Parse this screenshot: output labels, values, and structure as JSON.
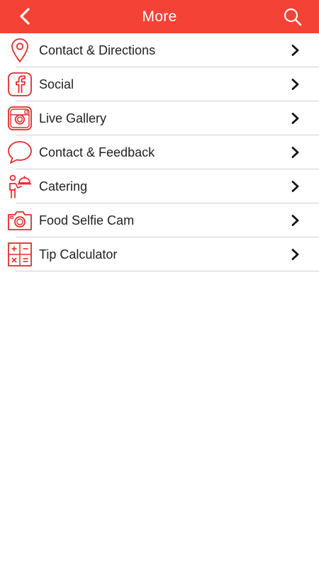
{
  "header": {
    "title": "More",
    "accent_color": "#f44336",
    "back_icon": "chevron-left-icon",
    "search_icon": "search-icon"
  },
  "menu": {
    "items": [
      {
        "label": "Contact & Directions",
        "icon": "map-pin-icon"
      },
      {
        "label": "Social",
        "icon": "facebook-icon"
      },
      {
        "label": "Live Gallery",
        "icon": "instagram-icon"
      },
      {
        "label": "Contact & Feedback",
        "icon": "speech-bubble-icon"
      },
      {
        "label": "Catering",
        "icon": "waiter-icon"
      },
      {
        "label": "Food Selfie Cam",
        "icon": "camera-icon"
      },
      {
        "label": "Tip Calculator",
        "icon": "calculator-icon"
      }
    ],
    "chevron_icon": "chevron-right-icon"
  }
}
